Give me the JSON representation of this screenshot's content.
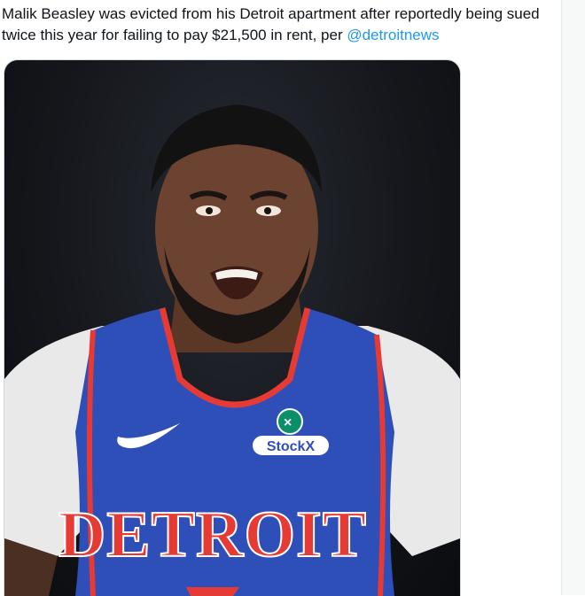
{
  "tweet": {
    "text": "Malik Beasley was evicted from his Detroit apartment after reportedly being sued twice this year for failing to pay $21,500 in rent, per ",
    "mention": "@detroitnews"
  },
  "media": {
    "jersey_text": "DETROIT",
    "sponsor_text": "StockX",
    "colors": {
      "jersey_blue": "#2f4fb8",
      "jersey_red": "#e63a35",
      "background": "#14161b",
      "skin": "#6b4330",
      "link": "#1d9bf0"
    }
  }
}
